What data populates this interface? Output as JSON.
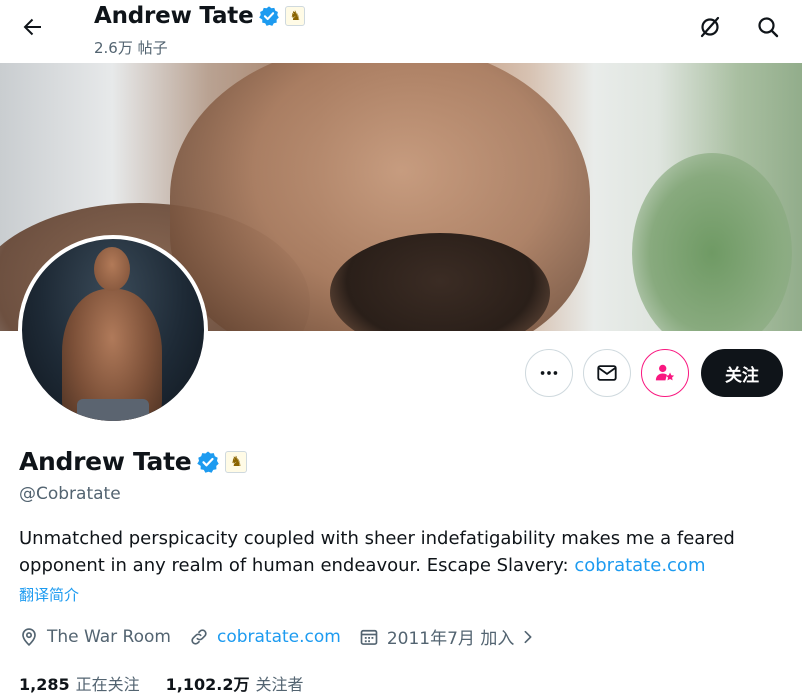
{
  "header": {
    "name": "Andrew Tate",
    "posts_count": "2.6万 帖子"
  },
  "profile": {
    "name": "Andrew Tate",
    "handle": "@Cobratate",
    "bio_text": "Unmatched perspicacity coupled with sheer indefatigability makes me a feared opponent in any realm of human endeavour. Escape Slavery: ",
    "bio_link": "cobratate.com",
    "translate_label": "翻译简介",
    "location": "The War Room",
    "website": "cobratate.com",
    "joined": "2011年7月 加入"
  },
  "actions": {
    "follow_label": "关注"
  },
  "stats": {
    "following_count": "1,285",
    "following_label": "正在关注",
    "followers_count": "1,102.2万",
    "followers_label": "关注者"
  },
  "icons": {
    "back": "arrow-left-icon",
    "grok": "grok-icon",
    "search": "search-icon",
    "more": "more-icon",
    "message": "mail-icon",
    "subscribe": "subscribe-icon",
    "location": "location-icon",
    "link": "link-icon",
    "calendar": "calendar-icon",
    "verified": "verified-badge-icon",
    "affiliate": "knight-chess-icon"
  },
  "colors": {
    "accent": "#1d9bf0",
    "text": "#0f1419",
    "secondary": "#536471",
    "pink": "#f91880",
    "follow_bg": "#0f1419"
  }
}
